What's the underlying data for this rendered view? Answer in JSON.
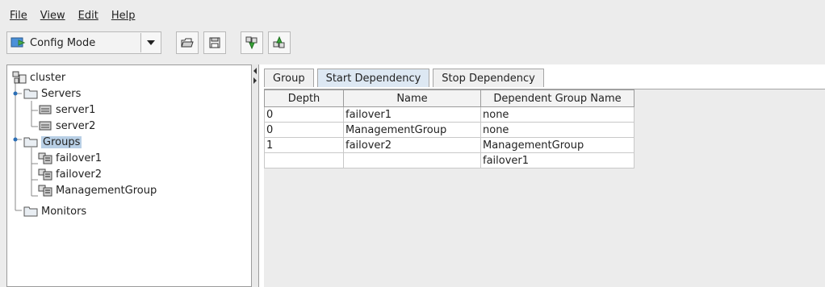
{
  "menu": [
    "File",
    "View",
    "Edit",
    "Help"
  ],
  "toolbar": {
    "mode_label": "Config Mode"
  },
  "tree": {
    "root": "cluster",
    "servers_label": "Servers",
    "servers": [
      "server1",
      "server2"
    ],
    "groups_label": "Groups",
    "groups": [
      "failover1",
      "failover2",
      "ManagementGroup"
    ],
    "monitors_label": "Monitors",
    "selected": "Groups"
  },
  "tabs": [
    {
      "label": "Group"
    },
    {
      "label": "Start Dependency"
    },
    {
      "label": "Stop Dependency"
    }
  ],
  "active_tab": "Start Dependency",
  "table": {
    "headers": [
      "Depth",
      "Name",
      "Dependent Group Name"
    ],
    "rows": [
      [
        "0",
        "failover1",
        "none"
      ],
      [
        "0",
        "ManagementGroup",
        "none"
      ],
      [
        "1",
        "failover2",
        "ManagementGroup"
      ],
      [
        "",
        "",
        "failover1"
      ]
    ]
  },
  "colors": {
    "selection": "#b8cfe5",
    "active_tab": "#dde8f3",
    "background": "#ececec"
  },
  "icons": {
    "mode": "mode-switch-icon",
    "toolbar": [
      "open-folder-icon",
      "save-icon",
      "download-icon",
      "upload-icon"
    ],
    "tree": [
      "cluster-icon",
      "folder-icon",
      "server-icon",
      "group-icon"
    ]
  }
}
